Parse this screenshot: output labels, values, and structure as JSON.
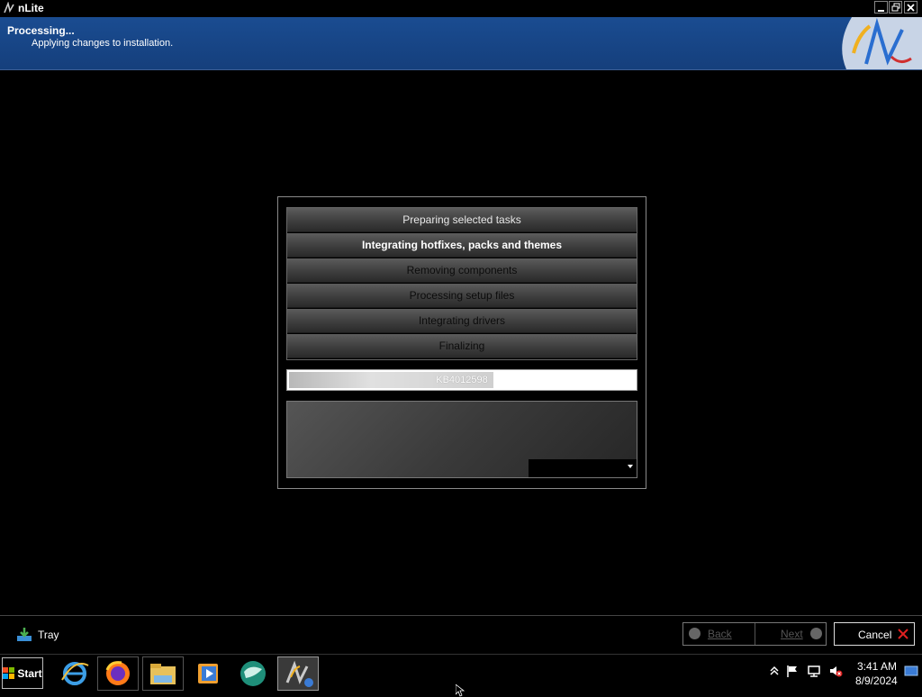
{
  "window": {
    "title": "nLite"
  },
  "header": {
    "title": "Processing...",
    "subtitle": "Applying changes to installation."
  },
  "steps": [
    {
      "label": "Preparing selected tasks",
      "state": "done"
    },
    {
      "label": "Integrating hotfixes, packs and themes",
      "state": "active"
    },
    {
      "label": "Removing components",
      "state": "pending"
    },
    {
      "label": "Processing setup files",
      "state": "pending"
    },
    {
      "label": "Integrating drivers",
      "state": "pending"
    },
    {
      "label": "Finalizing",
      "state": "pending"
    }
  ],
  "progress": {
    "label": "KB4012598",
    "fraction": 0.59
  },
  "bottom": {
    "tray_label": "Tray",
    "back_label": "Back",
    "next_label": "Next",
    "cancel_label": "Cancel"
  },
  "taskbar": {
    "start_label": "Start",
    "apps": [
      "internet-explorer-icon",
      "firefox-icon",
      "file-explorer-icon",
      "media-player-icon",
      "globe-app-icon",
      "nlite-icon"
    ],
    "clock_time": "3:41 AM",
    "clock_date": "8/9/2024"
  },
  "colors": {
    "header_blue": "#1a4c91",
    "cancel_red": "#e02020"
  }
}
